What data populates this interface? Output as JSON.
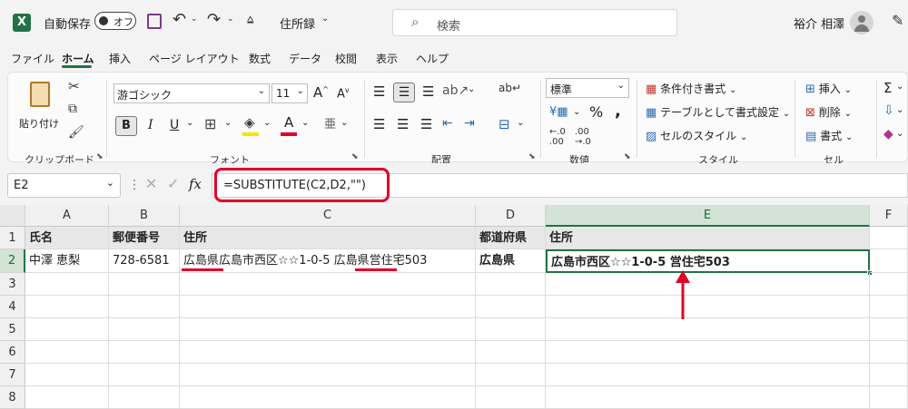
{
  "titlebar": {
    "autosave_label": "自動保存",
    "autosave_toggle": "オフ",
    "filename": "住所録",
    "search_placeholder": "検索",
    "user_name": "裕介 相澤"
  },
  "menu": [
    "ファイル",
    "ホーム",
    "挿入",
    "ページ レイアウト",
    "数式",
    "データ",
    "校閲",
    "表示",
    "ヘルプ"
  ],
  "ribbon": {
    "clipboard": {
      "paste": "貼り付け",
      "label": "クリップボード"
    },
    "font": {
      "name": "游ゴシック",
      "size": "11",
      "label": "フォント",
      "bold": "B",
      "italic": "I",
      "underline": "U"
    },
    "alignment": {
      "label": "配置"
    },
    "number": {
      "format": "標準",
      "label": "数値",
      "percent": "%"
    },
    "styles": {
      "conditional": "条件付き書式",
      "table": "テーブルとして書式設定",
      "cell": "セルのスタイル",
      "label": "スタイル"
    },
    "cells": {
      "insert": "挿入",
      "delete": "削除",
      "format": "書式",
      "label": "セル"
    }
  },
  "formula_bar": {
    "name_box": "E2",
    "fx": "fx",
    "formula": "=SUBSTITUTE(C2,D2,\"\")"
  },
  "sheet": {
    "columns": [
      "A",
      "B",
      "C",
      "D",
      "E",
      "F"
    ],
    "rows": [
      "1",
      "2",
      "3",
      "4",
      "5",
      "6",
      "7",
      "8"
    ],
    "header_row": {
      "A": "氏名",
      "B": "郵便番号",
      "C": "住所",
      "D": "都道府県",
      "E": "住所"
    },
    "data_row": {
      "A": "中澤 恵梨",
      "B": "728-6581",
      "C": "広島県広島市西区☆☆1-0-5 広島県営住宅503",
      "D": "広島県",
      "E": "広島市西区☆☆1-0-5 営住宅503"
    }
  },
  "colors": {
    "accent_red": "#e0002a",
    "excel_green": "#217346"
  }
}
